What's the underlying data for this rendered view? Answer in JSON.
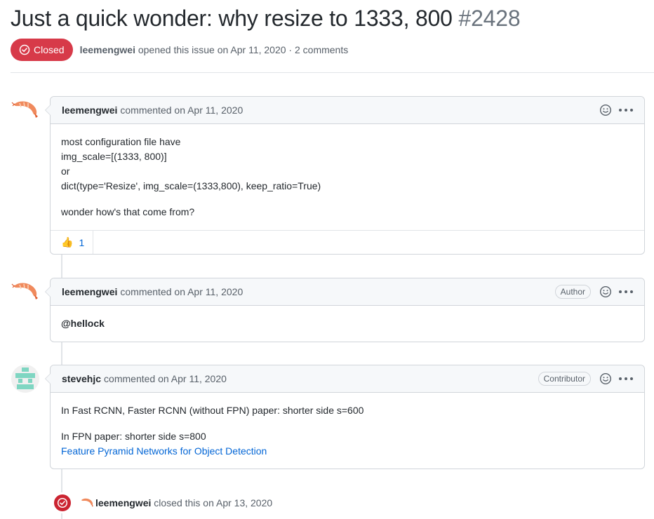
{
  "issue": {
    "title": "Just a quick wonder: why resize to 1333, 800",
    "number": "#2428",
    "state": "Closed",
    "author": "leemengwei",
    "opened_text": "opened this issue on Apr 11, 2020 · 2 comments"
  },
  "comments": [
    {
      "author": "leemengwei",
      "when": "commented on Apr 11, 2020",
      "role": "",
      "body_lines": [
        "most configuration file have",
        "img_scale=[(1333, 800)]",
        "or",
        "dict(type='Resize', img_scale=(1333,800), keep_ratio=True)"
      ],
      "body_p2": "wonder how's that come from?",
      "reaction_emoji": "👍",
      "reaction_count": "1"
    },
    {
      "author": "leemengwei",
      "when": "commented on Apr 11, 2020",
      "role": "Author",
      "mention": "@hellock"
    },
    {
      "author": "stevehjc",
      "when": "commented on Apr 11, 2020",
      "role": "Contributor",
      "p1": "In Fast RCNN, Faster RCNN (without FPN) paper: shorter side s=600",
      "p2": "In FPN paper: shorter side s=800",
      "link": "Feature Pyramid Networks for Object Detection"
    }
  ],
  "event": {
    "actor": "leemengwei",
    "text": "closed this on Apr 13, 2020"
  },
  "icons": {
    "state": "issue-closed-icon",
    "react": "smiley-icon",
    "more": "kebab-horizontal-icon"
  },
  "colors": {
    "closed_red": "#d73a49",
    "link_blue": "#0366d6",
    "muted": "#586069"
  }
}
